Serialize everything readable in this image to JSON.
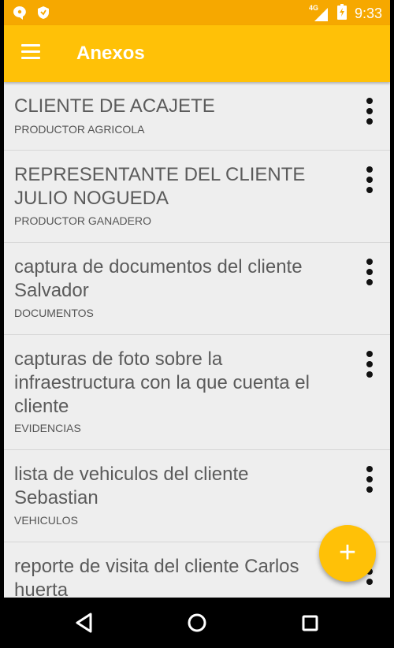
{
  "status_bar": {
    "network": "4G",
    "time": "9:33"
  },
  "app_bar": {
    "title": "Anexos"
  },
  "items": [
    {
      "title": "CLIENTE DE ACAJETE",
      "subtitle": "PRODUCTOR AGRICOLA"
    },
    {
      "title": "REPRESENTANTE DEL CLIENTE JULIO NOGUEDA",
      "subtitle": "PRODUCTOR GANADERO"
    },
    {
      "title": "captura de documentos del cliente Salvador",
      "subtitle": "DOCUMENTOS"
    },
    {
      "title": "capturas de foto sobre la infraestructura con la que cuenta el cliente",
      "subtitle": "EVIDENCIAS"
    },
    {
      "title": "lista de vehiculos del cliente Sebastian",
      "subtitle": "VEHICULOS"
    },
    {
      "title": "reporte de visita del cliente Carlos huerta",
      "subtitle": ""
    }
  ],
  "fab": {
    "label": "+"
  },
  "colors": {
    "status_bar": "#f6a800",
    "app_bar": "#ffc107",
    "accent": "#ffc107",
    "background": "#eeeeee"
  },
  "icons": {
    "menu": "hamburger-menu-icon",
    "more": "more-vert-icon",
    "back": "back-triangle-icon",
    "home": "home-circle-icon",
    "recents": "recents-square-icon"
  }
}
